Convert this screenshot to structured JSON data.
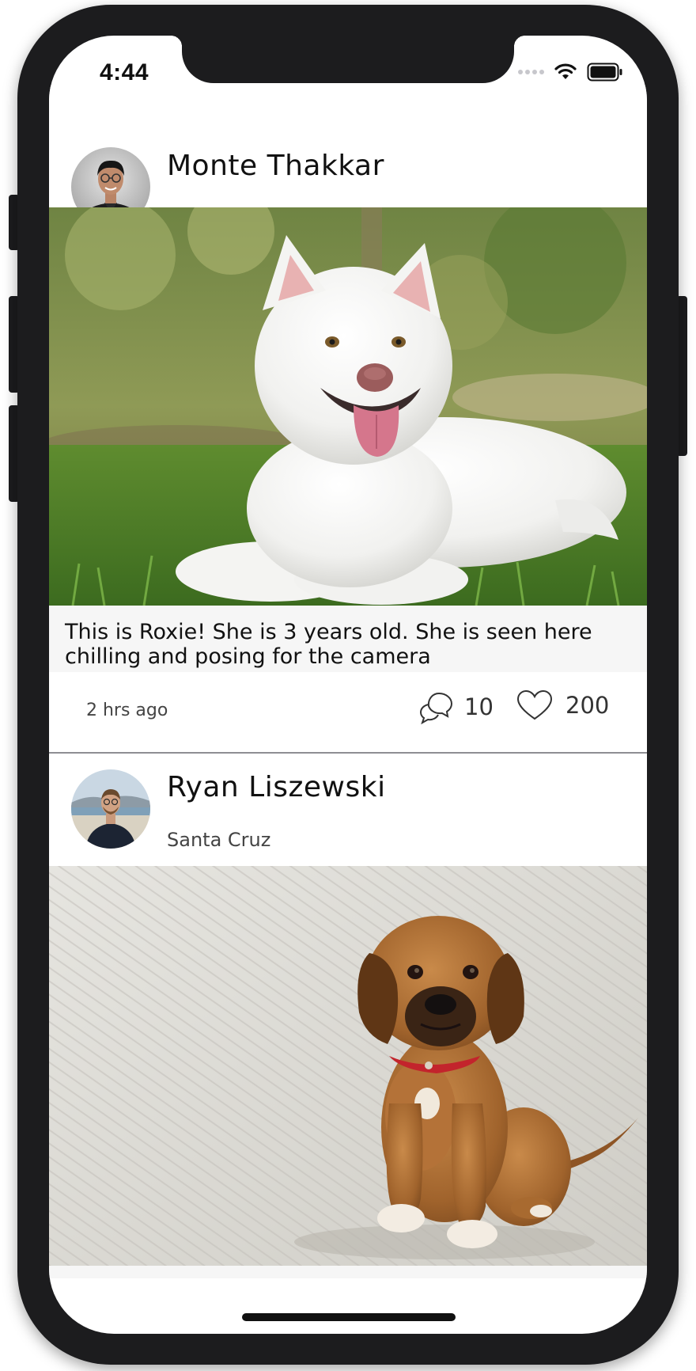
{
  "status_bar": {
    "time": "4:44"
  },
  "feed": {
    "posts": [
      {
        "author": "Monte Thakkar",
        "location": "",
        "image_subject": "white-dog",
        "caption": "This is Roxie! She is 3 years old. She is seen here chilling and posing for the camera",
        "timestamp": "2 hrs ago",
        "comments": "10",
        "likes": "200"
      },
      {
        "author": "Ryan Liszewski",
        "location": "Santa Cruz",
        "image_subject": "brown-puppy"
      }
    ]
  },
  "icons": {
    "comment": "comment-bubble-icon",
    "like": "heart-icon",
    "wifi": "wifi-icon",
    "battery": "battery-icon"
  },
  "colors": {
    "frame": "#1c1c1e",
    "caption_background": "#f6f6f6",
    "divider": "#8e8e93",
    "text": "#111111"
  }
}
